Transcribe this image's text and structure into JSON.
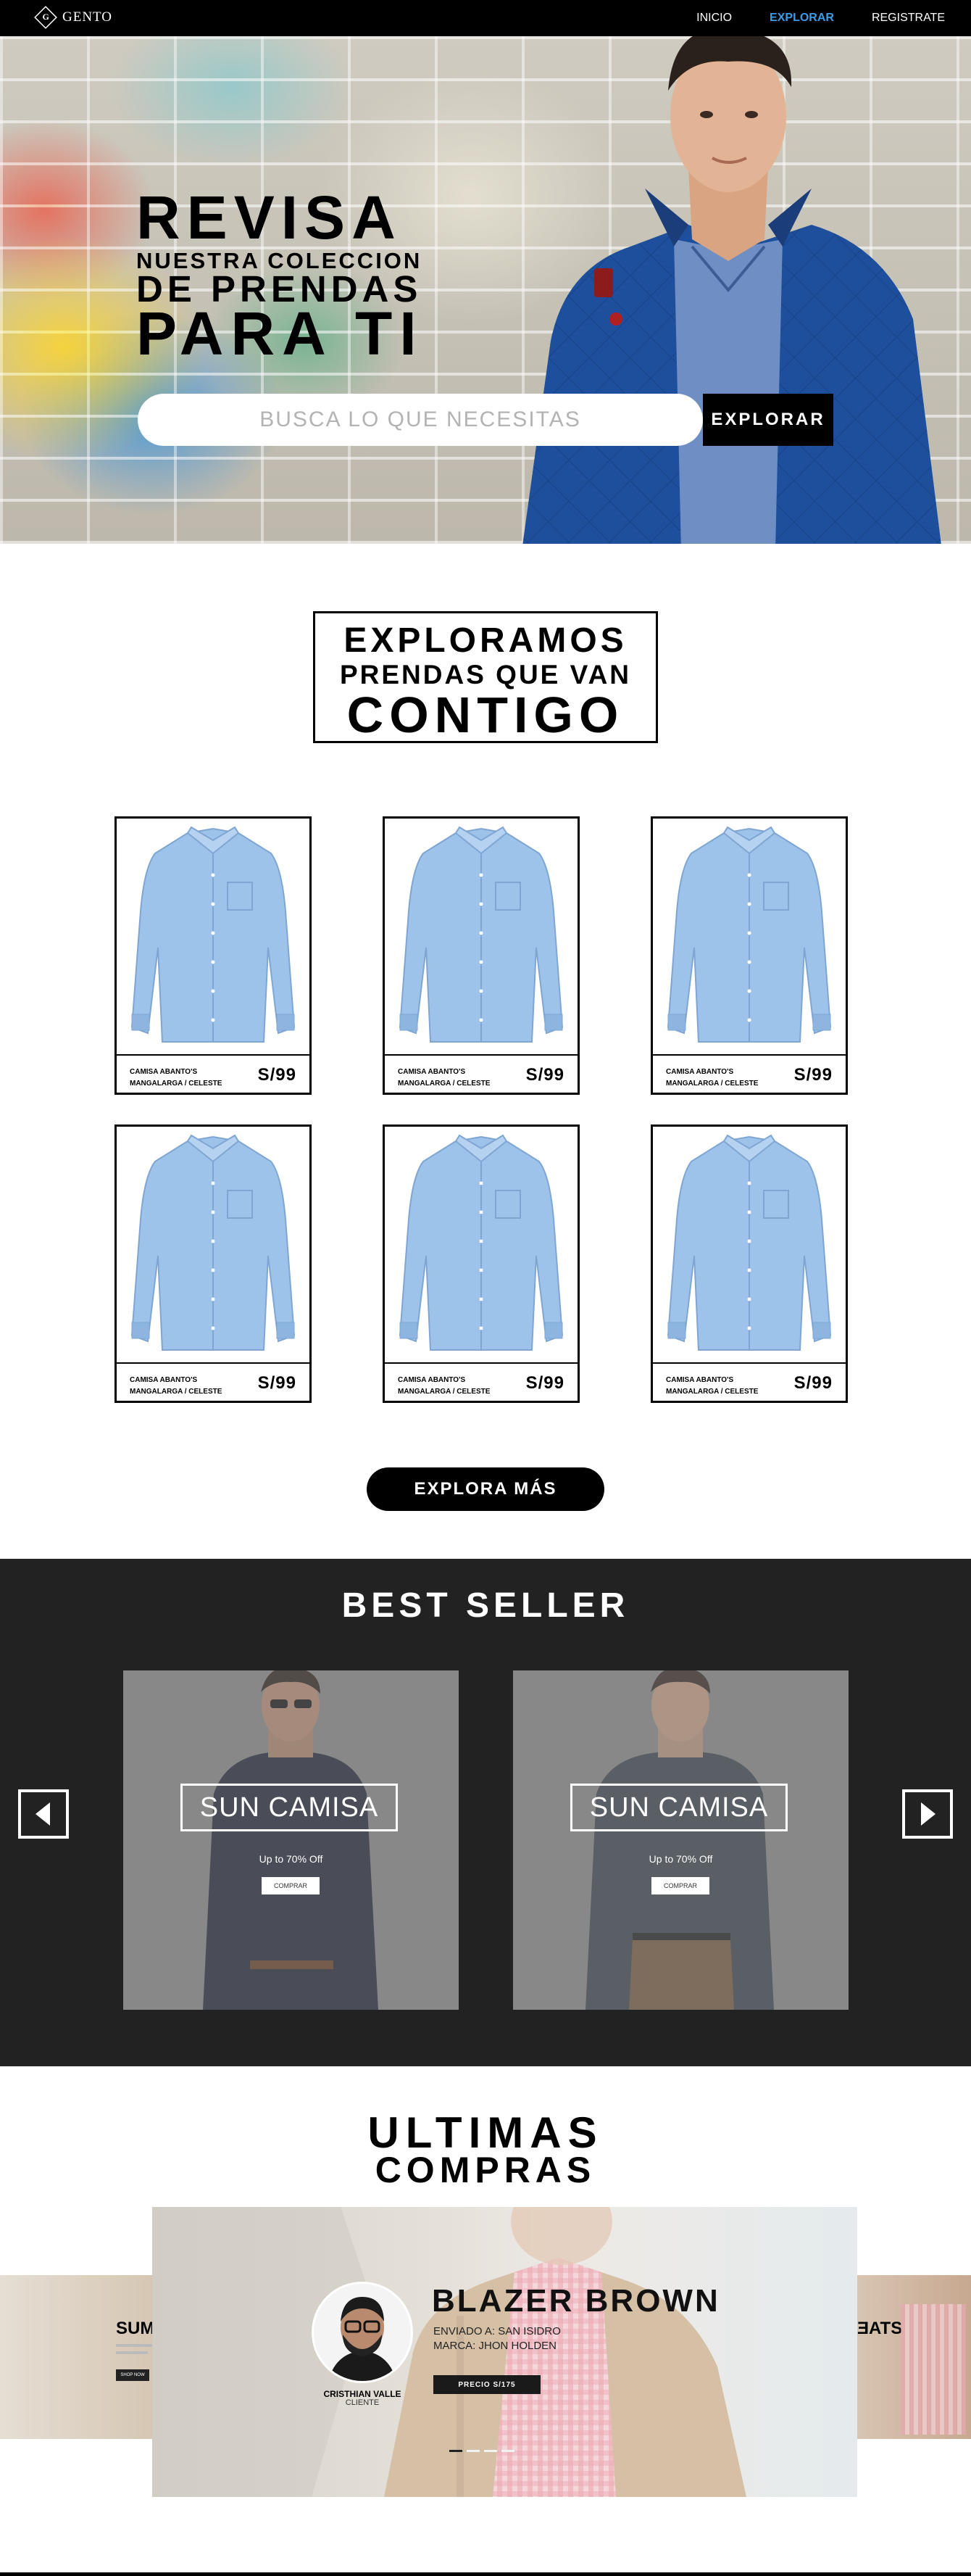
{
  "nav": {
    "logo_text": "GENTO",
    "logo_mark": "G",
    "links": [
      {
        "label": "INICIO",
        "active": false
      },
      {
        "label": "EXPLORAR",
        "active": true
      },
      {
        "label": "REGISTRATE",
        "active": false
      }
    ]
  },
  "hero": {
    "title_line1": "REVISA",
    "title_line2": "NUESTRA COLECCION",
    "title_line3": "DE PRENDAS",
    "title_line4": "PARA TI",
    "search_placeholder": "BUSCA LO QUE NECESITAS",
    "search_button": "EXPLORAR"
  },
  "explore": {
    "line1": "EXPLORAMOS",
    "line2": "PRENDAS QUE VAN",
    "line3": "CONTIGO"
  },
  "products": [
    {
      "name_line1": "CAMISA ABANTO'S",
      "name_line2": "MANGALARGA / CELESTE",
      "price": "S/99"
    },
    {
      "name_line1": "CAMISA ABANTO'S",
      "name_line2": "MANGALARGA / CELESTE",
      "price": "S/99"
    },
    {
      "name_line1": "CAMISA ABANTO'S",
      "name_line2": "MANGALARGA / CELESTE",
      "price": "S/99"
    },
    {
      "name_line1": "CAMISA ABANTO'S",
      "name_line2": "MANGALARGA / CELESTE",
      "price": "S/99"
    },
    {
      "name_line1": "CAMISA ABANTO'S",
      "name_line2": "MANGALARGA / CELESTE",
      "price": "S/99"
    },
    {
      "name_line1": "CAMISA ABANTO'S",
      "name_line2": "MANGALARGA / CELESTE",
      "price": "S/99"
    }
  ],
  "more_button": "EXPLORA MÁS",
  "best_seller": {
    "title": "BEST SELLER",
    "cards": [
      {
        "title": "SUN CAMISA",
        "offer": "Up to 70% Off",
        "button": "COMPRAR"
      },
      {
        "title": "SUN CAMISA",
        "offer": "Up to 70% Off",
        "button": "COMPRAR"
      }
    ],
    "prev_icon": "arrow-left-icon",
    "next_icon": "arrow-right-icon"
  },
  "recent": {
    "title_line1": "ULTIMAS",
    "title_line2": "COMPRAS",
    "product_title": "BLAZER BROWN",
    "sent_to": "ENVIADO A: SAN ISIDRO",
    "brand": "MARCA: JHON HOLDEN",
    "price_button": "PRECIO S/175",
    "customer_name": "CRISTHIAN VALLE",
    "customer_role": "CLIENTE",
    "side_left_title": "SUM",
    "side_right_title": "ƎATS",
    "side_left_button": "SHOP NOW"
  },
  "colors": {
    "nav_bg": "#000000",
    "accent": "#3b9ce8",
    "best_bg": "#222222",
    "shirt_blue": "#9ec3ea"
  }
}
